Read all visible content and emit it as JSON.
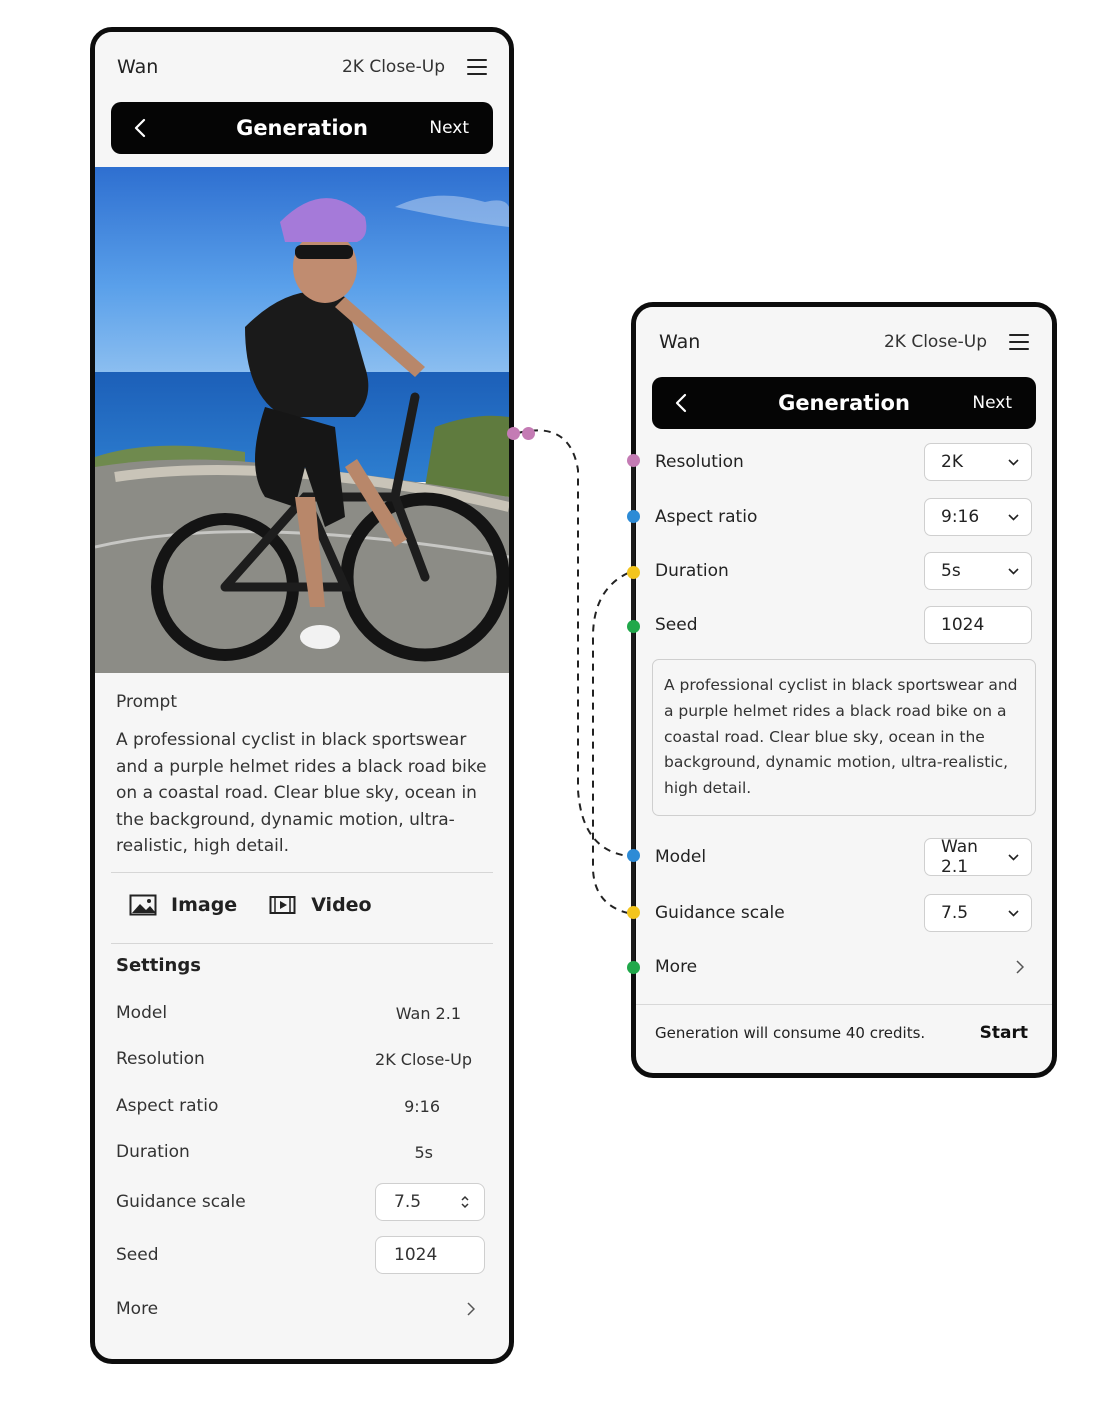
{
  "colors": {
    "accent_pink": "#c47bb4",
    "accent_blue": "#2d8bd6",
    "accent_yellow": "#f3c51c",
    "accent_green": "#20a84a",
    "header_bg": "#050505"
  },
  "left_screen": {
    "topbar": {
      "brand": "Wan",
      "mode": "2K Close-Up",
      "menu_icon": "hamburger-icon"
    },
    "genbar": {
      "title": "Generation",
      "next": "Next",
      "back_icon": "chevron-left-icon"
    },
    "prompt": {
      "label": "Prompt",
      "text": "A professional cyclist in black sportswear and a purple helmet rides a black road bike on a coastal road. Clear blue sky, ocean in the background, dynamic motion, ultra-realistic, high detail."
    },
    "media_tabs": [
      {
        "label": "Image",
        "icon": "image-icon"
      },
      {
        "label": "Video",
        "icon": "video-icon"
      }
    ],
    "settings": {
      "title": "Settings",
      "model": {
        "label": "Model",
        "value": "Wan 2.1"
      },
      "resolution": {
        "label": "Resolution",
        "value": "2K Close-Up"
      },
      "aspect_ratio": {
        "label": "Aspect ratio",
        "value": "9:16"
      },
      "duration": {
        "label": "Duration",
        "value": "5s"
      },
      "guidance_scale": {
        "label": "Guidance scale",
        "value": "7.5"
      },
      "seed": {
        "label": "Seed",
        "value": "1024"
      },
      "more": {
        "label": "More"
      }
    }
  },
  "right_screen": {
    "topbar": {
      "brand": "Wan",
      "mode": "2K Close-Up",
      "menu_icon": "hamburger-icon"
    },
    "genbar": {
      "title": "Generation",
      "next": "Next",
      "back_icon": "chevron-left-icon"
    },
    "fields": {
      "resolution": {
        "label": "Resolution",
        "value": "2K"
      },
      "aspect_ratio": {
        "label": "Aspect ratio",
        "value": "9:16"
      },
      "duration": {
        "label": "Duration",
        "value": "5s"
      },
      "seed": {
        "label": "Seed",
        "value": "1024"
      },
      "model": {
        "label": "Model",
        "value": "Wan 2.1"
      },
      "guidance_scale": {
        "label": "Guidance scale",
        "value": "7.5"
      },
      "more": {
        "label": "More"
      }
    },
    "prompt": "A professional cyclist in black sportswear and a purple helmet rides a black road bike on a coastal road. Clear blue sky, ocean in the background, dynamic motion, ultra-realistic, high detail.",
    "footer": {
      "credits": "Generation will consume 40 credits.",
      "start": "Start"
    }
  }
}
